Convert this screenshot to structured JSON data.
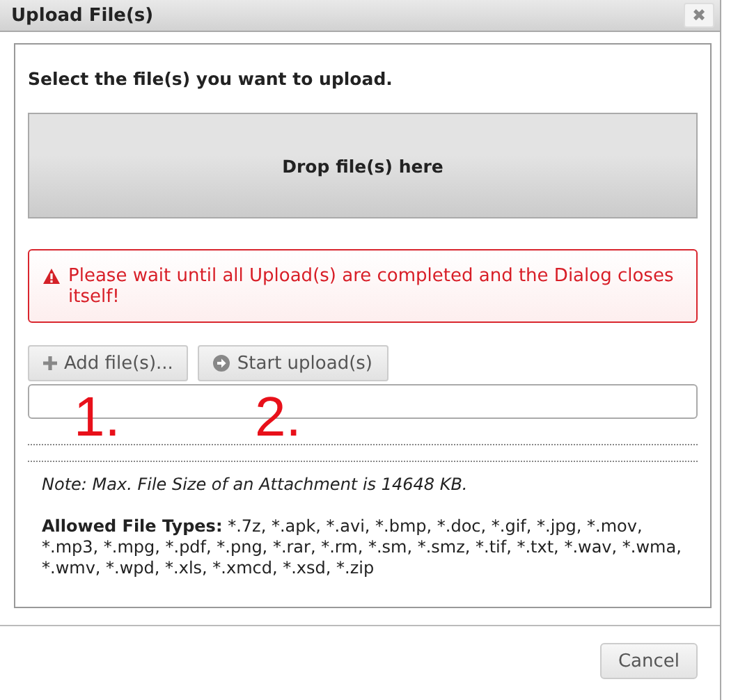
{
  "dialog": {
    "title": "Upload File(s)",
    "close_label": "✖"
  },
  "prompt": "Select the file(s) you want to upload.",
  "drop_zone": {
    "label": "Drop file(s) here"
  },
  "alert": {
    "message": "Please wait until all Upload(s) are completed and the Dialog closes itself!"
  },
  "buttons": [
    {
      "kind": "add",
      "label": "Add file(s)..."
    },
    {
      "kind": "start",
      "label": "Start upload(s)"
    }
  ],
  "annotations": [
    {
      "text": "1."
    },
    {
      "text": "2."
    }
  ],
  "note": "Note: Max. File Size of an Attachment is 14648 KB.",
  "allowed_types": {
    "label": "Allowed File Types:",
    "value": "*.7z, *.apk, *.avi, *.bmp, *.doc, *.gif, *.jpg, *.mov, *.mp3, *.mpg, *.pdf, *.png, *.rar, *.rm, *.sm, *.smz, *.tif, *.txt, *.wav, *.wma, *.wmv, *.wpd, *.xls, *.xmcd, *.xsd, *.zip"
  },
  "footer": {
    "cancel": "Cancel"
  }
}
